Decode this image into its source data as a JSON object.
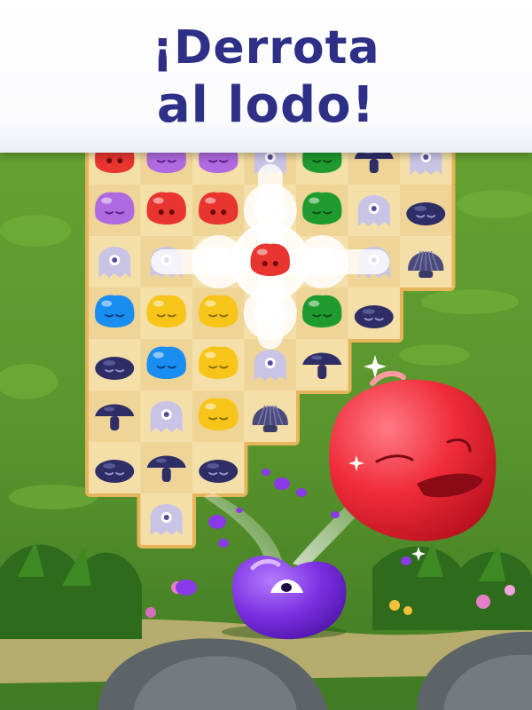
{
  "headline": {
    "line1": "¡Derrota",
    "line2": "al lodo!",
    "color": "#2e2f86"
  },
  "board": {
    "rows": [
      [
        "red-jelly",
        "purple-jelly",
        "purple-jelly",
        "ghost",
        "green-jelly",
        "mushroom",
        "ghost"
      ],
      [
        "purple-jelly",
        "red-jelly",
        "red-jelly",
        "burst",
        "green-jelly",
        "ghost",
        "blob"
      ],
      [
        "ghost",
        "ghost",
        "burst",
        "red-jelly",
        "burst",
        "ghost",
        "shell"
      ],
      [
        "blue-jelly",
        "yellow-jelly",
        "yellow-jelly",
        "burst",
        "green-jelly",
        "blob",
        null
      ],
      [
        "blob",
        "blue-jelly",
        "yellow-jelly",
        "ghost",
        "mushroom",
        null,
        null
      ],
      [
        "mushroom",
        "ghost",
        "yellow-jelly",
        "shell",
        null,
        null,
        null
      ],
      [
        "blob",
        "mushroom",
        "blob",
        null,
        null,
        null,
        null
      ],
      [
        null,
        "ghost",
        null,
        null,
        null,
        null,
        null
      ]
    ]
  },
  "colors": {
    "tile": "#f4dfa8",
    "board_border": "#e6b45a",
    "grass": "#5f9a2e",
    "red": "#e8352f",
    "purple_jelly": "#b06ae0",
    "green": "#1f9a2e",
    "blue": "#1a8ef0",
    "yellow": "#f7c51a",
    "ghost": "#c9c4e6",
    "blob": "#2e2d66",
    "big_red": "#f02d3a",
    "big_purple": "#7a2fe0"
  }
}
